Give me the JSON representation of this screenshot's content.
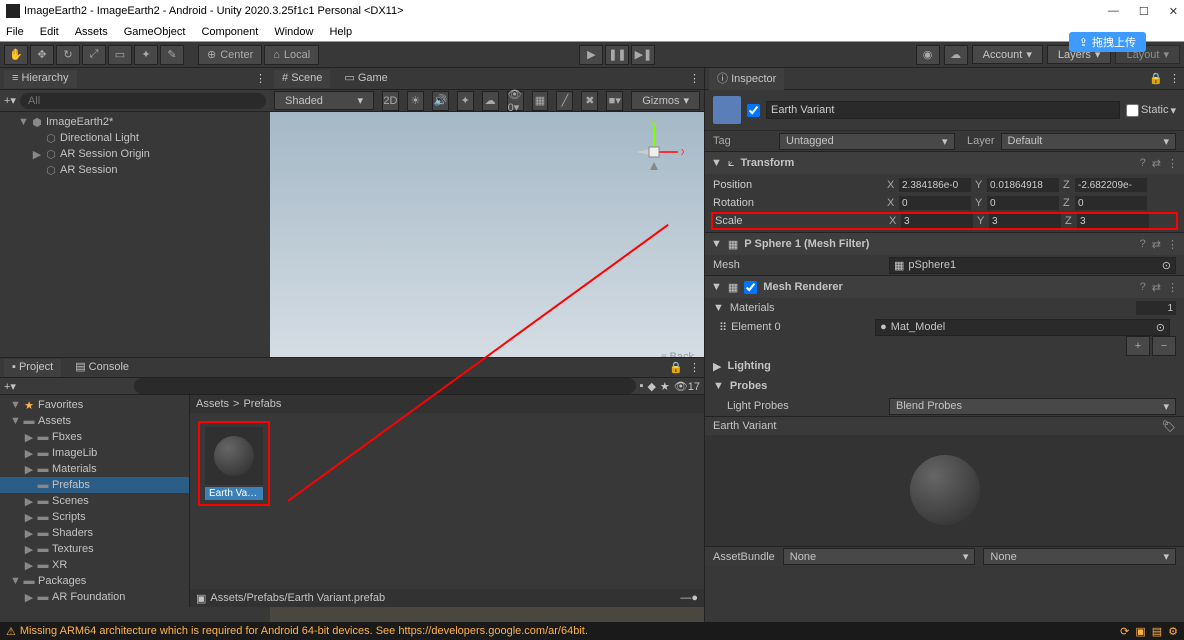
{
  "titlebar": {
    "text": "ImageEarth2 - ImageEarth2 - Android - Unity 2020.3.25f1c1 Personal <DX11>"
  },
  "menu": [
    "File",
    "Edit",
    "Assets",
    "GameObject",
    "Component",
    "Window",
    "Help"
  ],
  "toolbar": {
    "center_label": "Center",
    "local_label": "Local",
    "account": "Account",
    "layers": "Layers",
    "layout": "Layout",
    "blue_badge": "拖拽上传"
  },
  "hierarchy": {
    "tab": "Hierarchy",
    "search_placeholder": "All",
    "items": [
      {
        "indent": 0,
        "icon": "unity",
        "label": "ImageEarth2*",
        "arrow": "▼"
      },
      {
        "indent": 1,
        "icon": "cube",
        "label": "Directional Light",
        "arrow": ""
      },
      {
        "indent": 1,
        "icon": "cube",
        "label": "AR Session Origin",
        "arrow": "▶"
      },
      {
        "indent": 1,
        "icon": "cube",
        "label": "AR Session",
        "arrow": ""
      }
    ]
  },
  "scene": {
    "tab_scene": "Scene",
    "tab_game": "Game",
    "shading": "Shaded",
    "mode_2d": "2D",
    "gizmos": "Gizmos",
    "back": "Back",
    "axes": {
      "x": "x",
      "y": "y"
    }
  },
  "project": {
    "tab_project": "Project",
    "tab_console": "Console",
    "eye_count": "17",
    "tree": [
      {
        "indent": 0,
        "label": "Favorites",
        "icon": "star",
        "arrow": "▼"
      },
      {
        "indent": 0,
        "label": "Assets",
        "icon": "folder",
        "arrow": "▼"
      },
      {
        "indent": 1,
        "label": "Fbxes",
        "icon": "folder",
        "arrow": "▶"
      },
      {
        "indent": 1,
        "label": "ImageLib",
        "icon": "folder",
        "arrow": "▶"
      },
      {
        "indent": 1,
        "label": "Materials",
        "icon": "folder",
        "arrow": "▶"
      },
      {
        "indent": 1,
        "label": "Prefabs",
        "icon": "folder",
        "arrow": "",
        "selected": true
      },
      {
        "indent": 1,
        "label": "Scenes",
        "icon": "folder",
        "arrow": "▶"
      },
      {
        "indent": 1,
        "label": "Scripts",
        "icon": "folder",
        "arrow": "▶"
      },
      {
        "indent": 1,
        "label": "Shaders",
        "icon": "folder",
        "arrow": "▶"
      },
      {
        "indent": 1,
        "label": "Textures",
        "icon": "folder",
        "arrow": "▶"
      },
      {
        "indent": 1,
        "label": "XR",
        "icon": "folder",
        "arrow": "▶"
      },
      {
        "indent": 0,
        "label": "Packages",
        "icon": "folder",
        "arrow": "▼"
      },
      {
        "indent": 1,
        "label": "AR Foundation",
        "icon": "folder",
        "arrow": "▶"
      }
    ],
    "breadcrumb": [
      "Assets",
      "Prefabs"
    ],
    "asset_name": "Earth Vari...",
    "footer_path": "Assets/Prefabs/Earth Variant.prefab"
  },
  "inspector": {
    "tab": "Inspector",
    "name": "Earth Variant",
    "static": "Static",
    "tag_label": "Tag",
    "tag_value": "Untagged",
    "layer_label": "Layer",
    "layer_value": "Default",
    "transform": {
      "title": "Transform",
      "rows": [
        {
          "label": "Position",
          "x": "2.384186e-0",
          "y": "0.01864918",
          "z": "-2.682209e-"
        },
        {
          "label": "Rotation",
          "x": "0",
          "y": "0",
          "z": "0"
        },
        {
          "label": "Scale",
          "x": "3",
          "y": "3",
          "z": "3"
        }
      ]
    },
    "mesh_filter": {
      "title": "P Sphere 1 (Mesh Filter)",
      "mesh_label": "Mesh",
      "mesh_value": "pSphere1"
    },
    "mesh_renderer": {
      "title": "Mesh Renderer",
      "materials_label": "Materials",
      "materials_count": "1",
      "element_label": "Element 0",
      "element_value": "Mat_Model"
    },
    "lighting": "Lighting",
    "probes": {
      "title": "Probes",
      "light_probes_label": "Light Probes",
      "light_probes_value": "Blend Probes"
    },
    "preview_title": "Earth Variant",
    "assetbundle_label": "AssetBundle",
    "assetbundle_value": "None",
    "assetbundle_value2": "None"
  },
  "status": {
    "message": "Missing ARM64 architecture which is required for Android 64-bit devices. See https://developers.google.com/ar/64bit."
  }
}
